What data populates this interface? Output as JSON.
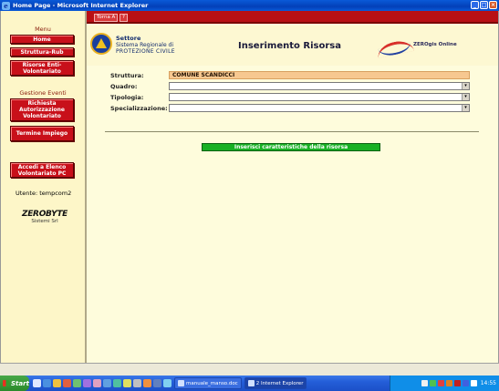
{
  "window": {
    "title": "Home Page - Microsoft Internet Explorer"
  },
  "sidebar": {
    "menu_title": "Menu",
    "menu_items": [
      {
        "label": "Home"
      },
      {
        "label": "Struttura-Rub"
      },
      {
        "label": "Risorse Enti-Volontariato"
      }
    ],
    "events_title": "Gestione Eventi",
    "event_items": [
      {
        "label": "Richiesta Autorizzazione Volontariato"
      },
      {
        "label": "Termine Impiego"
      }
    ],
    "access_item": {
      "label": "Accedi a Elenco Volontariato PC"
    },
    "user_text": "Utente: tempcom2",
    "vendor": {
      "name": "ZEROBYTE",
      "sub": "Sistemi Srl"
    }
  },
  "topbar": {
    "tabs": [
      "Torna A",
      "?"
    ]
  },
  "header": {
    "org_line1": "Settore",
    "org_line2": "Sistema Regionale di",
    "org_line3": "PROTEZIONE CIVILE",
    "page_title": "Inserimento Risorsa",
    "brand": "ZEROgis Online"
  },
  "form": {
    "fields": [
      {
        "label": "Struttura:",
        "value": "COMUNE SCANDICCI",
        "type": "readonly"
      },
      {
        "label": "Quadro:",
        "value": "",
        "type": "select"
      },
      {
        "label": "Tipologia:",
        "value": "",
        "type": "select"
      },
      {
        "label": "Specializzazione:",
        "value": "",
        "type": "select"
      }
    ],
    "action_button": "Inserisci caratteristiche della risorsa"
  },
  "taskbar": {
    "start_label": "Start",
    "tasks": [
      {
        "label": "manuale_manso.doc",
        "active": false
      },
      {
        "label": "2 Internet Explorer",
        "active": true
      }
    ],
    "clock": "14:55"
  }
}
